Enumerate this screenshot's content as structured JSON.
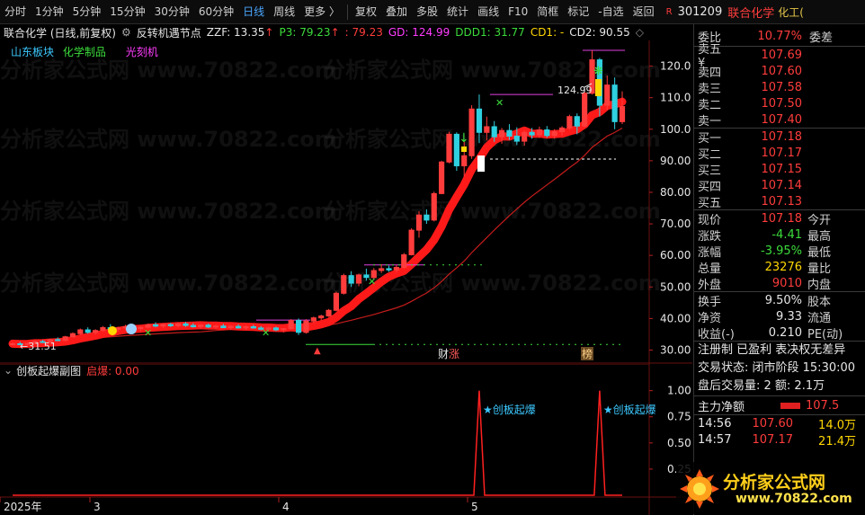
{
  "toolbar": {
    "left_items": [
      "分时",
      "1分钟",
      "5分钟",
      "15分钟",
      "30分钟",
      "60分钟",
      "日线",
      "周线",
      "更多 〉"
    ],
    "active": "日线",
    "right_items": [
      "复权",
      "叠加",
      "多股",
      "统计",
      "画线",
      "F10",
      "简框",
      "标记",
      "-自选",
      "返回"
    ],
    "r_badge": "R",
    "stock_code": "301209",
    "stock_name": "联合化学",
    "sector_short": "化工("
  },
  "info_line": {
    "title": "联合化学 (日线,前复权)",
    "indicator": "反转机遇节点",
    "zzf": "ZZF: 13.35",
    "p3": "P3: 79.23",
    "p3b": ": 79.23",
    "gd": "GD: 124.99",
    "ddd1": "DDD1: 31.77",
    "cd1": "CD1: -",
    "cd2": "CD2: 90.55"
  },
  "tags": {
    "sector1": "山东板块",
    "sector2": "化学制品",
    "sector3": "光刻机"
  },
  "chart_data": {
    "type": "candlestick",
    "y_ticks": [
      "120.0",
      "110.0",
      "100.0",
      "90.00",
      "80.00",
      "70.00",
      "60.00",
      "50.00",
      "40.00",
      "30.00"
    ],
    "ylim": [
      27,
      127
    ],
    "x_ticks": [
      "2025年",
      "3",
      "4",
      "5"
    ],
    "high_label": "124.99",
    "low_label": "←31.51",
    "marker_cai": "财",
    "marker_zhang": "涨",
    "marker_bang": "榜",
    "candles": [
      {
        "o": 31.7,
        "h": 32.3,
        "l": 31.5,
        "c": 32.0
      },
      {
        "o": 32.0,
        "h": 32.6,
        "l": 31.6,
        "c": 31.8
      },
      {
        "o": 31.8,
        "h": 32.4,
        "l": 31.4,
        "c": 32.1
      },
      {
        "o": 32.1,
        "h": 33.0,
        "l": 31.9,
        "c": 32.7
      },
      {
        "o": 32.7,
        "h": 33.2,
        "l": 32.2,
        "c": 32.4
      },
      {
        "o": 32.4,
        "h": 33.6,
        "l": 32.2,
        "c": 33.3
      },
      {
        "o": 33.3,
        "h": 34.0,
        "l": 32.8,
        "c": 33.0
      },
      {
        "o": 33.0,
        "h": 34.5,
        "l": 32.8,
        "c": 34.2
      },
      {
        "o": 34.2,
        "h": 35.6,
        "l": 34.0,
        "c": 35.2
      },
      {
        "o": 35.2,
        "h": 36.8,
        "l": 34.8,
        "c": 36.4
      },
      {
        "o": 36.4,
        "h": 37.2,
        "l": 35.2,
        "c": 35.6
      },
      {
        "o": 35.6,
        "h": 36.6,
        "l": 34.9,
        "c": 36.2
      },
      {
        "o": 36.2,
        "h": 37.6,
        "l": 35.8,
        "c": 37.1
      },
      {
        "o": 37.1,
        "h": 38.2,
        "l": 36.2,
        "c": 36.6
      },
      {
        "o": 36.6,
        "h": 37.4,
        "l": 35.8,
        "c": 37.0
      },
      {
        "o": 37.0,
        "h": 38.0,
        "l": 36.4,
        "c": 37.4
      },
      {
        "o": 37.4,
        "h": 38.2,
        "l": 36.4,
        "c": 36.8
      },
      {
        "o": 36.8,
        "h": 37.6,
        "l": 36.0,
        "c": 37.2
      },
      {
        "o": 37.2,
        "h": 38.4,
        "l": 36.8,
        "c": 38.0
      },
      {
        "o": 38.0,
        "h": 38.8,
        "l": 37.2,
        "c": 37.6
      },
      {
        "o": 37.6,
        "h": 38.4,
        "l": 37.0,
        "c": 38.1
      },
      {
        "o": 38.1,
        "h": 38.6,
        "l": 37.3,
        "c": 37.7
      },
      {
        "o": 37.7,
        "h": 38.6,
        "l": 37.2,
        "c": 38.3
      },
      {
        "o": 38.3,
        "h": 38.9,
        "l": 37.4,
        "c": 37.8
      },
      {
        "o": 37.8,
        "h": 38.5,
        "l": 37.1,
        "c": 37.4
      },
      {
        "o": 37.4,
        "h": 38.2,
        "l": 36.8,
        "c": 37.9
      },
      {
        "o": 37.9,
        "h": 38.4,
        "l": 37.0,
        "c": 37.3
      },
      {
        "o": 37.3,
        "h": 38.0,
        "l": 36.6,
        "c": 37.6
      },
      {
        "o": 37.6,
        "h": 38.3,
        "l": 37.0,
        "c": 37.1
      },
      {
        "o": 37.1,
        "h": 37.9,
        "l": 36.4,
        "c": 37.5
      },
      {
        "o": 37.5,
        "h": 38.2,
        "l": 36.9,
        "c": 37.0
      },
      {
        "o": 37.0,
        "h": 37.8,
        "l": 36.4,
        "c": 37.4
      },
      {
        "o": 37.4,
        "h": 38.0,
        "l": 36.8,
        "c": 37.0
      },
      {
        "o": 37.0,
        "h": 37.6,
        "l": 36.2,
        "c": 36.6
      },
      {
        "o": 36.6,
        "h": 37.4,
        "l": 35.9,
        "c": 37.0
      },
      {
        "o": 37.0,
        "h": 37.4,
        "l": 36.0,
        "c": 36.4
      },
      {
        "o": 36.4,
        "h": 37.0,
        "l": 35.6,
        "c": 36.8
      },
      {
        "o": 36.8,
        "h": 39.8,
        "l": 36.5,
        "c": 39.4
      },
      {
        "o": 39.4,
        "h": 40.0,
        "l": 34.8,
        "c": 35.6
      },
      {
        "o": 35.6,
        "h": 39.8,
        "l": 35.2,
        "c": 39.2
      },
      {
        "o": 39.2,
        "h": 40.6,
        "l": 38.6,
        "c": 40.2
      },
      {
        "o": 40.2,
        "h": 41.2,
        "l": 39.4,
        "c": 40.8
      },
      {
        "o": 40.8,
        "h": 43.0,
        "l": 40.5,
        "c": 42.6
      },
      {
        "o": 42.6,
        "h": 48.5,
        "l": 42.3,
        "c": 48.0
      },
      {
        "o": 48.0,
        "h": 54.2,
        "l": 47.6,
        "c": 53.6
      },
      {
        "o": 53.6,
        "h": 55.0,
        "l": 50.0,
        "c": 51.2
      },
      {
        "o": 51.2,
        "h": 54.2,
        "l": 50.2,
        "c": 53.8
      },
      {
        "o": 53.8,
        "h": 55.8,
        "l": 52.0,
        "c": 53.0
      },
      {
        "o": 53.0,
        "h": 56.0,
        "l": 52.4,
        "c": 55.2
      },
      {
        "o": 55.2,
        "h": 57.2,
        "l": 54.4,
        "c": 55.8
      },
      {
        "o": 55.8,
        "h": 56.8,
        "l": 54.8,
        "c": 55.4
      },
      {
        "o": 55.4,
        "h": 57.0,
        "l": 54.6,
        "c": 56.2
      },
      {
        "o": 56.2,
        "h": 60.8,
        "l": 55.8,
        "c": 60.2
      },
      {
        "o": 60.2,
        "h": 68.6,
        "l": 60.0,
        "c": 68.0
      },
      {
        "o": 68.0,
        "h": 74.0,
        "l": 65.6,
        "c": 72.8
      },
      {
        "o": 72.8,
        "h": 74.6,
        "l": 70.0,
        "c": 71.2
      },
      {
        "o": 71.2,
        "h": 80.2,
        "l": 70.8,
        "c": 79.6
      },
      {
        "o": 79.6,
        "h": 90.0,
        "l": 79.4,
        "c": 89.6
      },
      {
        "o": 89.6,
        "h": 99.2,
        "l": 89.2,
        "c": 98.4
      },
      {
        "o": 98.4,
        "h": 99.0,
        "l": 86.8,
        "c": 88.4
      },
      {
        "o": 88.4,
        "h": 96.0,
        "l": 85.0,
        "c": 91.6
      },
      {
        "o": 91.6,
        "h": 107.6,
        "l": 90.6,
        "c": 106.4
      },
      {
        "o": 106.4,
        "h": 111.0,
        "l": 95.6,
        "c": 99.0
      },
      {
        "o": 99.0,
        "h": 104.0,
        "l": 96.4,
        "c": 100.8
      },
      {
        "o": 100.8,
        "h": 102.6,
        "l": 96.0,
        "c": 97.6
      },
      {
        "o": 97.6,
        "h": 100.4,
        "l": 95.4,
        "c": 99.6
      },
      {
        "o": 99.6,
        "h": 101.6,
        "l": 96.6,
        "c": 97.8
      },
      {
        "o": 97.8,
        "h": 100.6,
        "l": 95.0,
        "c": 96.2
      },
      {
        "o": 96.2,
        "h": 99.6,
        "l": 94.8,
        "c": 99.0
      },
      {
        "o": 99.0,
        "h": 100.4,
        "l": 97.0,
        "c": 98.2
      },
      {
        "o": 98.2,
        "h": 100.8,
        "l": 97.2,
        "c": 99.8
      },
      {
        "o": 99.8,
        "h": 101.0,
        "l": 97.4,
        "c": 98.0
      },
      {
        "o": 98.0,
        "h": 100.0,
        "l": 97.0,
        "c": 99.2
      },
      {
        "o": 99.2,
        "h": 101.0,
        "l": 98.0,
        "c": 100.4
      },
      {
        "o": 100.4,
        "h": 104.6,
        "l": 99.8,
        "c": 104.0
      },
      {
        "o": 104.0,
        "h": 105.0,
        "l": 98.4,
        "c": 101.0
      },
      {
        "o": 101.0,
        "h": 112.0,
        "l": 100.6,
        "c": 111.4
      },
      {
        "o": 111.4,
        "h": 124.99,
        "l": 111.0,
        "c": 122.0
      },
      {
        "o": 122.0,
        "h": 122.6,
        "l": 104.0,
        "c": 107.6
      },
      {
        "o": 107.6,
        "h": 117.0,
        "l": 106.0,
        "c": 114.0
      },
      {
        "o": 114.0,
        "h": 116.4,
        "l": 100.0,
        "c": 102.4
      },
      {
        "o": 102.4,
        "h": 112.0,
        "l": 101.6,
        "c": 107.18
      }
    ],
    "sub_chart": {
      "title": "创板起爆副图",
      "status": "启爆: 0.00",
      "y_ticks": [
        "1.00",
        "0.75",
        "0.50",
        "0.25"
      ],
      "ylim": [
        0,
        1.1
      ],
      "spikes": [
        62,
        78
      ],
      "spike_label": "★创板起爆"
    }
  },
  "quote": {
    "weibi_label": "委比",
    "weibi_val": "10.77%",
    "weicha_label": "委差",
    "asks": [
      {
        "label": "卖五 ¥",
        "price": "107.69"
      },
      {
        "label": "卖四",
        "price": "107.60"
      },
      {
        "label": "卖三",
        "price": "107.58"
      },
      {
        "label": "卖二",
        "price": "107.50"
      },
      {
        "label": "卖一",
        "price": "107.40"
      }
    ],
    "bids": [
      {
        "label": "买一",
        "price": "107.18"
      },
      {
        "label": "买二",
        "price": "107.17"
      },
      {
        "label": "买三",
        "price": "107.15"
      },
      {
        "label": "买四",
        "price": "107.14"
      },
      {
        "label": "买五",
        "price": "107.13"
      }
    ],
    "stats": [
      {
        "k": "现价",
        "v": "107.18",
        "k2": "今开",
        "color": "red"
      },
      {
        "k": "涨跌",
        "v": "-4.41",
        "k2": "最高",
        "color": "green"
      },
      {
        "k": "涨幅",
        "v": "-3.95%",
        "k2": "最低",
        "color": "green"
      },
      {
        "k": "总量",
        "v": "23276",
        "k2": "量比",
        "color": "yellow"
      },
      {
        "k": "外盘",
        "v": "9010",
        "k2": "内盘",
        "color": "red"
      }
    ],
    "stats2": [
      {
        "k": "换手",
        "v": "9.50%",
        "k2": "股本",
        "color": "white"
      },
      {
        "k": "净资",
        "v": "9.33",
        "k2": "流通",
        "color": "white"
      },
      {
        "k": "收益(-)",
        "v": "0.210",
        "k2": "PE(动)",
        "color": "white"
      }
    ],
    "notes": [
      "注册制 已盈利 表决权无差异",
      "交易状态: 闭市阶段 15:30:00",
      "盘后交易量: 2  额: 2.1万"
    ],
    "main_flow_label": "主力净额",
    "main_flow_val": "107.5",
    "ticks": [
      {
        "t": "14:56",
        "p": "107.60",
        "amt": "14.0万"
      },
      {
        "t": "14:57",
        "p": "107.17",
        "amt": "21.4万"
      }
    ]
  },
  "watermark": "分析家公式网 www.70822.com",
  "logo": {
    "text": "分析家公式网",
    "url": "www.70822.com"
  },
  "colors": {
    "up": "#ff3c3c",
    "down": "#2fd0e0",
    "ma_thick": "#ff1a1a",
    "ma_thin": "#c41c1c",
    "bg": "#000000"
  }
}
